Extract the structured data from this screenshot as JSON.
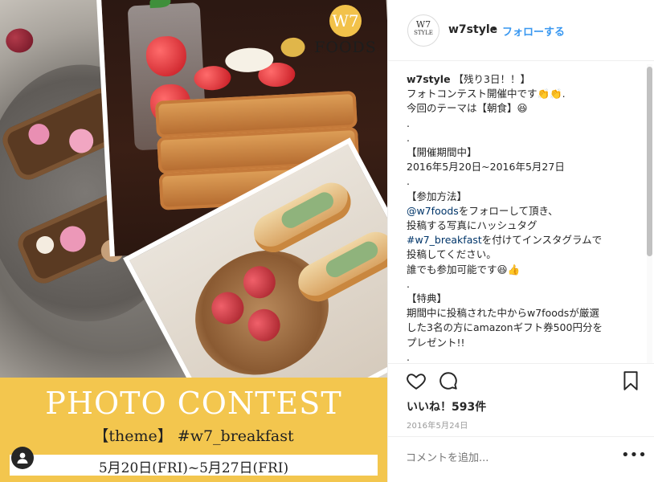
{
  "image": {
    "logo_badge": "W7",
    "logo_text": "FOODS",
    "banner_title": "PHOTO CONTEST",
    "banner_theme": "【theme】 #w7_breakfast",
    "banner_dates": "5月20日(FRI)~5月27日(FRI)"
  },
  "header": {
    "avatar_line1": "W7",
    "avatar_line2": "STYLE",
    "username": "w7style",
    "dot": "•",
    "follow_label": "フォローする"
  },
  "caption": {
    "username": "w7style",
    "lines": [
      " 【残り3日！！】",
      "フォトコンテスト開催中です👏👏.",
      "今回のテーマは【朝食】😆",
      ".",
      ".",
      "【開催期間中】",
      "2016年5月20日~2016年5月27日",
      ".",
      "【参加方法】",
      "をフォローして頂き、",
      "投稿する写真にハッシュタグ",
      "を付けてインスタグラムで",
      "投稿してください。",
      "誰でも参加可能です😆👍",
      ".",
      "【特典】",
      "期間中に投稿された中からw7foodsが厳選",
      "した3名の方にamazonギフト券500円分を",
      "プレゼント!!",
      "."
    ],
    "mention": "@w7foods",
    "hashtag": "#w7_breakfast"
  },
  "actions": {
    "like_icon": "heart-icon",
    "comment_icon": "comment-icon",
    "save_icon": "bookmark-icon"
  },
  "likes": "いいね！593件",
  "date": "2016年5月24日",
  "comment": {
    "placeholder": "コメントを追加...",
    "more_label": "•••"
  },
  "colors": {
    "accent_blue": "#3897f0",
    "banner_yellow": "#f3c64e",
    "text": "#262626",
    "muted": "#999999"
  }
}
